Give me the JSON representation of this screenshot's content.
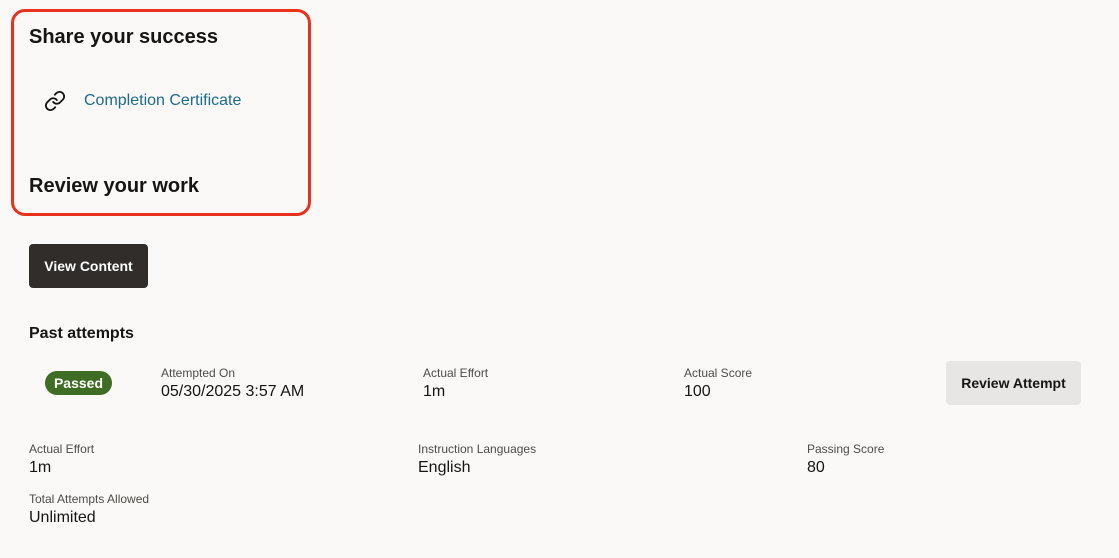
{
  "share": {
    "title": "Share your success",
    "certificate_link": "Completion Certificate",
    "certificate_icon": "link-icon"
  },
  "review": {
    "title": "Review your work",
    "view_content_label": "View Content"
  },
  "past_attempts": {
    "title": "Past attempts",
    "attempt": {
      "status": "Passed",
      "status_color": "#3f6d25",
      "attempted_on_label": "Attempted On",
      "attempted_on_value": "05/30/2025 3:57 AM",
      "effort_label": "Actual Effort",
      "effort_value": "1m",
      "score_label": "Actual Score",
      "score_value": "100",
      "review_button_label": "Review Attempt"
    }
  },
  "summary": {
    "effort_label": "Actual Effort",
    "effort_value": "1m",
    "languages_label": "Instruction Languages",
    "languages_value": "English",
    "passing_label": "Passing Score",
    "passing_value": "80",
    "attempts_label": "Total Attempts Allowed",
    "attempts_value": "Unlimited"
  },
  "colors": {
    "highlight_border": "#e8321d",
    "link": "#1b6b8a",
    "primary_button": "#312d2a",
    "secondary_button": "#e8e6e4"
  }
}
